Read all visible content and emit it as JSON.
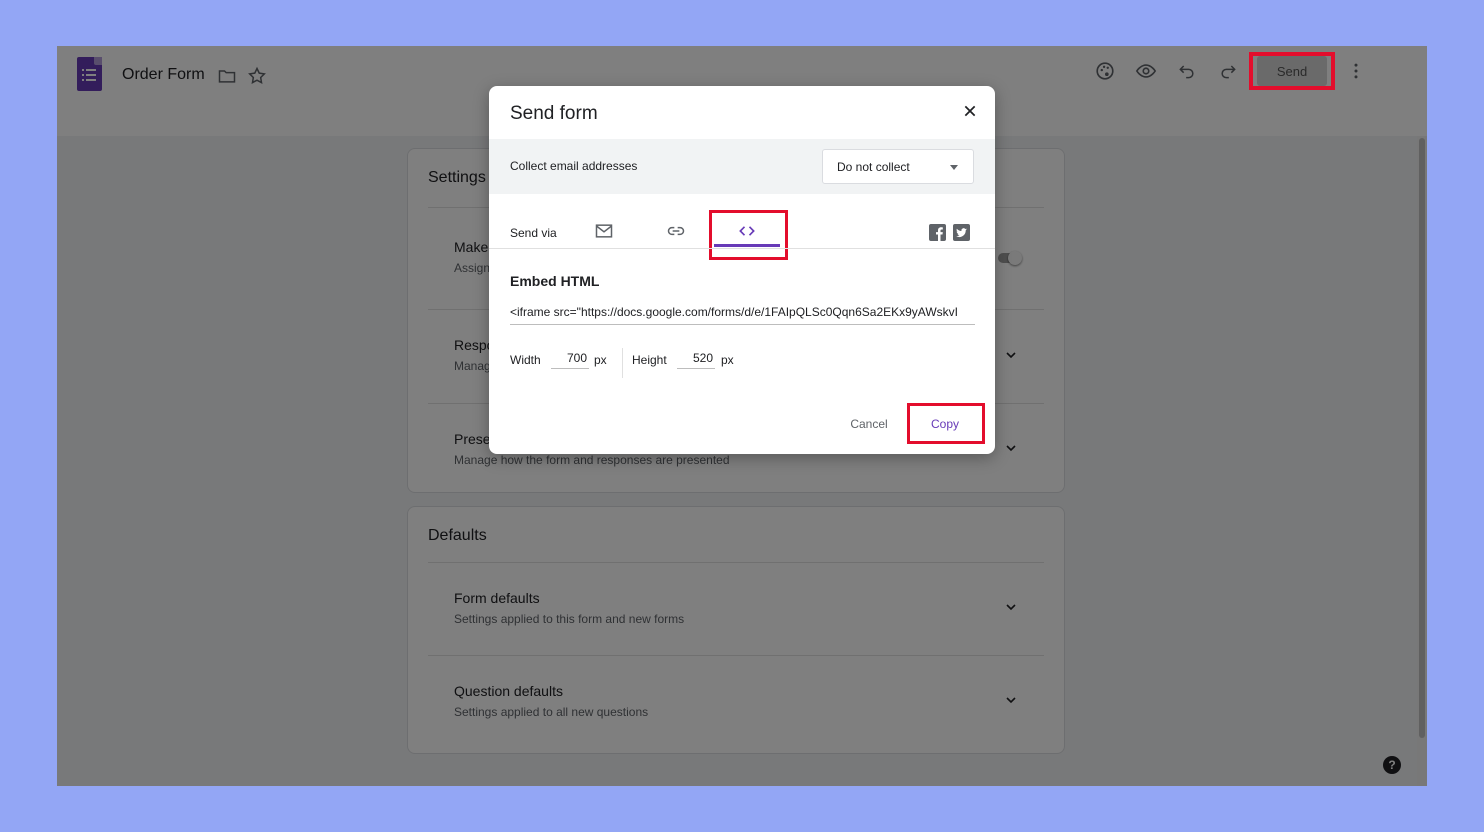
{
  "header": {
    "title": "Order Form",
    "icons": [
      "forms-logo-icon",
      "folder-icon",
      "star-icon",
      "palette-icon",
      "eye-icon",
      "undo-icon",
      "redo-icon",
      "more-vert-icon"
    ],
    "send_label": "Send"
  },
  "settings": {
    "title": "Settings",
    "rows": [
      {
        "title": "Make",
        "subtitle": "Assign"
      },
      {
        "title": "Respo",
        "subtitle": "Manag"
      },
      {
        "title": "Prese",
        "subtitle": "Manage how the form and responses are presented"
      }
    ]
  },
  "defaults": {
    "title": "Defaults",
    "rows": [
      {
        "title": "Form defaults",
        "subtitle": "Settings applied to this form and new forms"
      },
      {
        "title": "Question defaults",
        "subtitle": "Settings applied to all new questions"
      }
    ]
  },
  "help": {
    "label": "?"
  },
  "dialog": {
    "title": "Send form",
    "collect_label": "Collect email addresses",
    "collect_value": "Do not collect",
    "send_via_label": "Send via",
    "send_via_options": [
      "email-icon",
      "link-icon",
      "embed-code-icon"
    ],
    "selected_option": "embed-code-icon",
    "social": [
      "facebook-icon",
      "twitter-icon"
    ],
    "embed_title": "Embed HTML",
    "embed_code": "<iframe src=\"https://docs.google.com/forms/d/e/1FAIpQLSc0Qqn6Sa2EKx9yAWskvI",
    "width_label": "Width",
    "width_value": "700",
    "height_label": "Height",
    "height_value": "520",
    "unit": "px",
    "cancel_label": "Cancel",
    "copy_label": "Copy"
  },
  "colors": {
    "background": "#93a6f5",
    "forms_purple": "#673ab7",
    "highlight_red": "#e30d2c"
  }
}
